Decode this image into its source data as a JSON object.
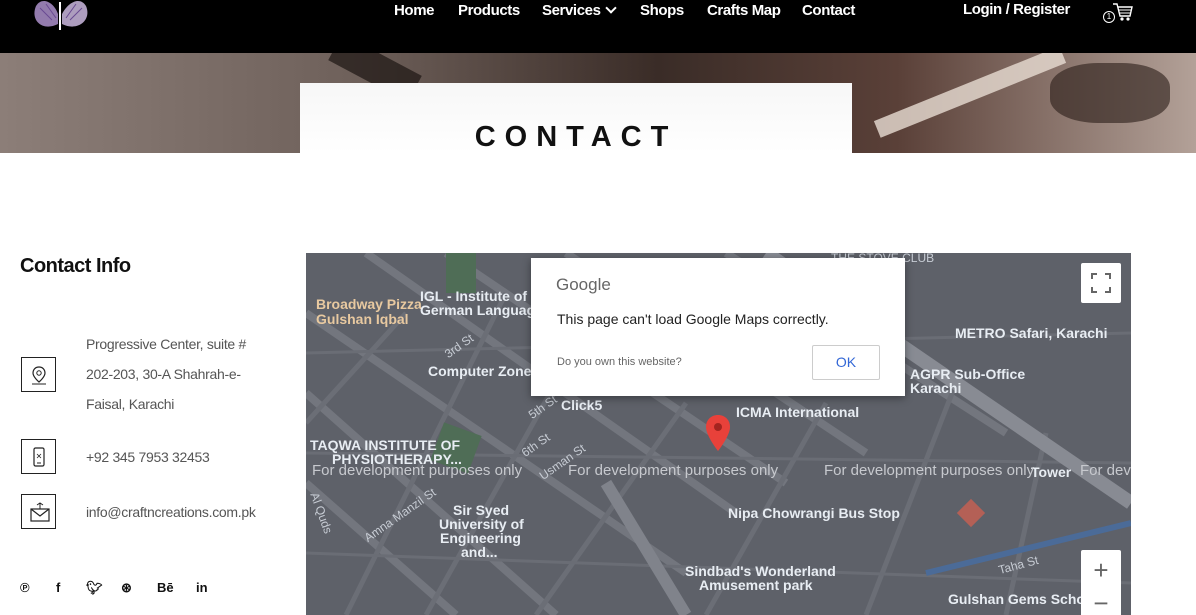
{
  "nav": {
    "links": [
      "Home",
      "Products",
      "Services",
      "Shops",
      "Crafts Map",
      "Contact"
    ],
    "login": "Login / Register",
    "cart_count": "1"
  },
  "hero": {
    "title": "CONTACT"
  },
  "contact": {
    "heading": "Contact Info",
    "address": "Progressive Center, suite # 202-203, 30-A Shahrah-e-Faisal, Karachi",
    "phone": "+92 345 7953 32453",
    "email": "info@craftncreations.com.pk",
    "social": [
      "pinterest-icon",
      "facebook-icon",
      "twitter-icon",
      "dribbble-icon",
      "behance-icon",
      "linkedin-icon"
    ]
  },
  "map": {
    "labels": {
      "broadway": "Broadway Pizza",
      "gulshan": "Gulshan Iqbal",
      "igl1": "IGL - Institute of",
      "igl2": "German Language",
      "computer": "Computer Zone",
      "click5": "Click5",
      "icma": "ICMA International",
      "taqwa1": "TAQWA INSTITUTE OF",
      "taqwa2": "PHYSIOTHERAPY...",
      "metro": "METRO Safari, Karachi",
      "agpr1": "AGPR Sub-Office",
      "agpr2": "Karachi",
      "sir1": "Sir Syed",
      "sir2": "University of",
      "sir3": "Engineering",
      "sir4": "and...",
      "nipa": "Nipa Chowrangi Bus Stop",
      "sind1": "Sindbad's Wonderland",
      "sind2": "Amusement park",
      "gulshan_gems": "Gulshan Gems School",
      "stove": "THE STOVE CLUB",
      "tower": "Tower",
      "taha": "Taha St",
      "aamna": "Amna Manzil St",
      "usman": "Usman St",
      "third": "3rd St",
      "fifth": "5th St",
      "sixth": "6th St",
      "alquds": "Al Quds"
    },
    "watermark": "For development purposes only",
    "dialog": {
      "brand": "Google",
      "message": "This page can't load Google Maps correctly.",
      "link": "Do you own this website?",
      "ok": "OK"
    },
    "zoom_in": "+",
    "zoom_out": "−"
  }
}
